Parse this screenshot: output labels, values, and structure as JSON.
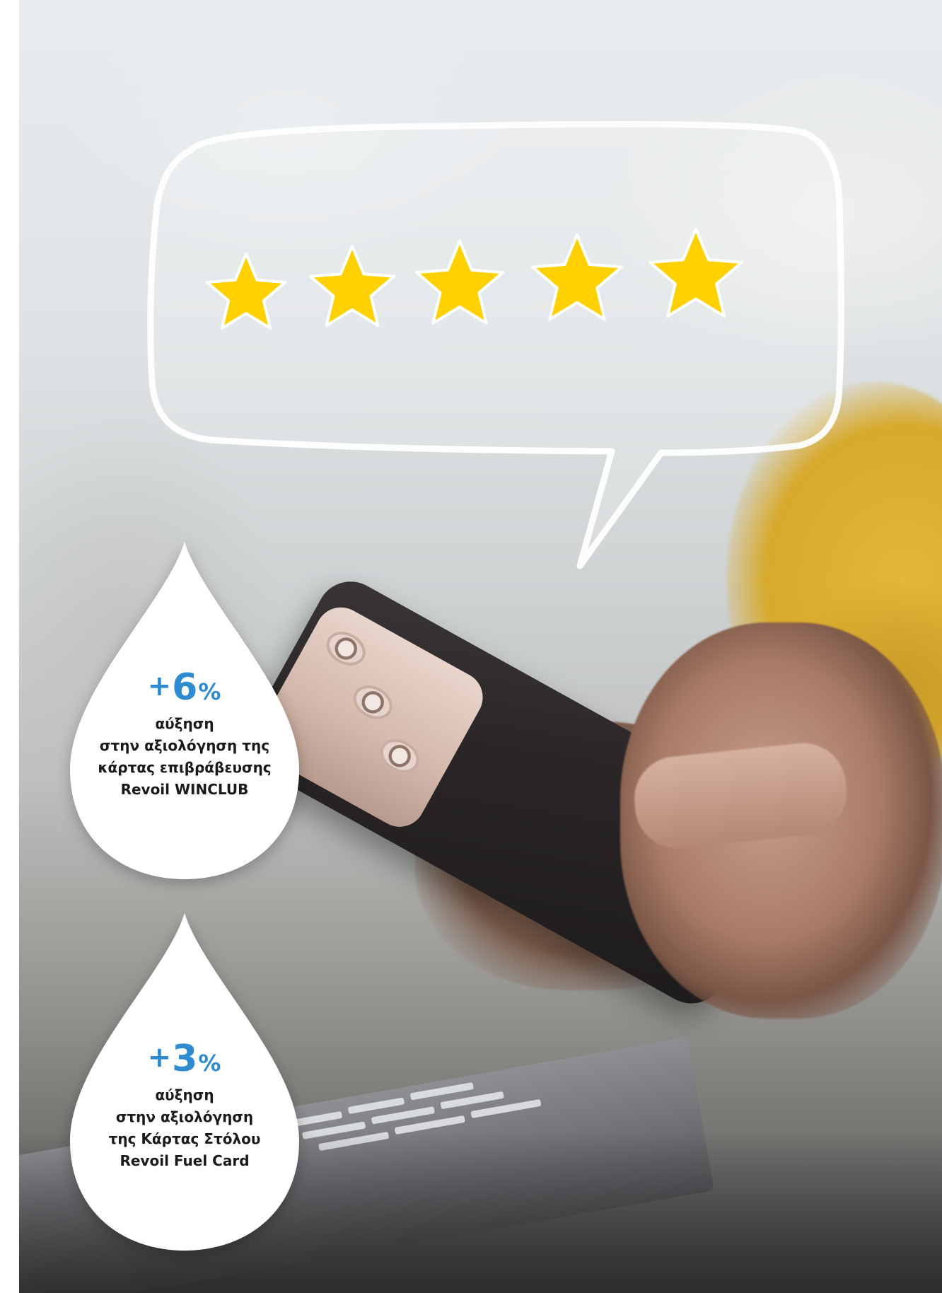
{
  "rating": {
    "stars": 5,
    "max_stars": 5,
    "star_color": "#FFD100"
  },
  "drops": [
    {
      "value_sign": "+",
      "value_number": "6",
      "value_unit": "%",
      "lines": [
        "αύξηση",
        "στην αξιολόγηση της",
        "κάρτας επιβράβευσης",
        "Revoil WINCLUB"
      ]
    },
    {
      "value_sign": "+",
      "value_number": "3",
      "value_unit": "%",
      "lines": [
        "αύξηση",
        "στην αξιολόγηση",
        "της Κάρτας Στόλου",
        "Revoil Fuel Card"
      ]
    }
  ],
  "colors": {
    "accent": "#2E8BD0",
    "text": "#1A1A1A"
  }
}
